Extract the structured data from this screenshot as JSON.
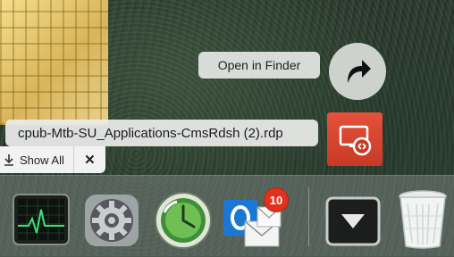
{
  "tooltip": {
    "text": "Open in Finder"
  },
  "download": {
    "filename": "cpub-Mtb-SU_Applications-CmsRdsh (2).rdp",
    "show_all_label": "Show All",
    "close_label": "✕"
  },
  "dock": {
    "items": [
      {
        "name": "Activity Monitor",
        "icon": "activity-monitor-icon"
      },
      {
        "name": "System Preferences",
        "icon": "gear-icon"
      },
      {
        "name": "Time Machine",
        "icon": "time-machine-icon"
      },
      {
        "name": "Outlook",
        "icon": "outlook-icon"
      },
      {
        "name": "Downloads",
        "icon": "downloads-stack-icon"
      },
      {
        "name": "Trash",
        "icon": "trash-icon"
      }
    ],
    "mail_badge": "10"
  },
  "colors": {
    "rdp_red": "#d8432d",
    "badge_red": "#e0321e"
  }
}
